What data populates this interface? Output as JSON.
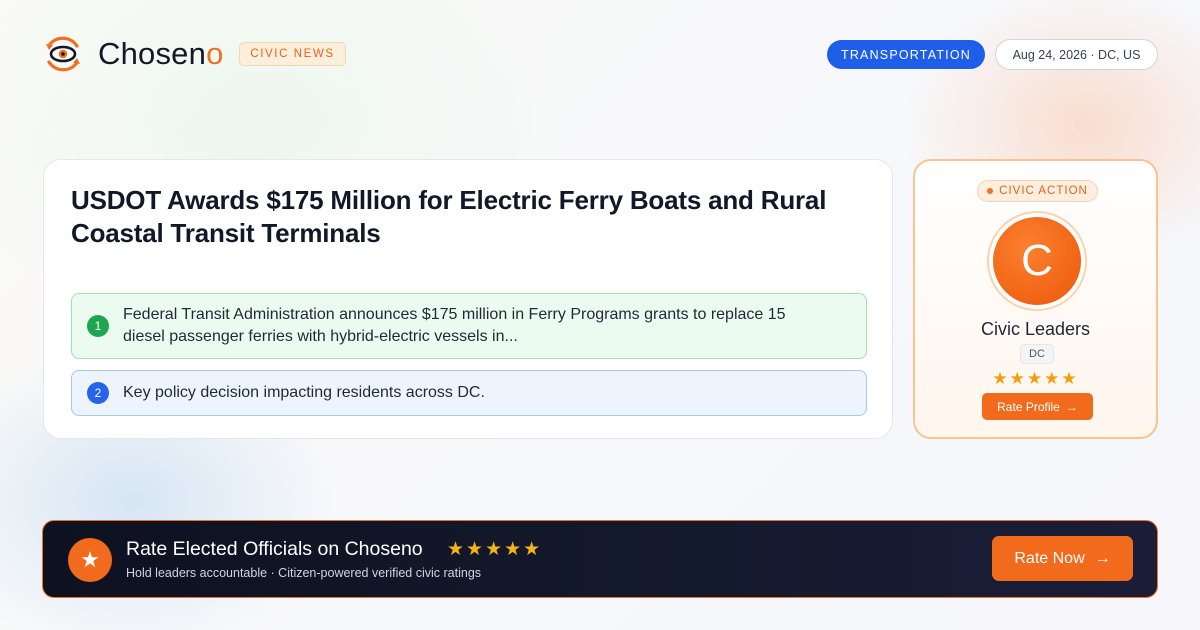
{
  "brand": {
    "name_prefix": "Chosen",
    "name_suffix": "o",
    "tag": "CIVIC NEWS",
    "accent_color": "#f07021",
    "icon": "eye-logo-icon"
  },
  "header": {
    "topic": "TRANSPORTATION",
    "date_location": "Aug 24, 2026 · DC, US"
  },
  "article": {
    "headline": "USDOT Awards $175 Million for Electric Ferry Boats and Rural Coastal Transit Terminals",
    "points": [
      {
        "number": "1",
        "text": "Federal Transit Administration announces $175 million in Ferry Programs grants to replace 15 diesel passenger ferries with hybrid-electric vessels in..."
      },
      {
        "number": "2",
        "text": "Key policy decision impacting residents across DC."
      }
    ]
  },
  "profile": {
    "badge": "CIVIC ACTION",
    "avatar_initial": "C",
    "name": "Civic Leaders",
    "region": "DC",
    "stars": "★★★★★",
    "rating": 5,
    "button_label": "Rate Profile",
    "button_arrow": "→"
  },
  "banner": {
    "icon": "star-icon",
    "icon_glyph": "★",
    "title": "Rate Elected Officials on Choseno",
    "stars": "★★★★★",
    "subtitle": "Hold leaders accountable · Citizen-powered verified civic ratings",
    "button_label": "Rate Now",
    "button_arrow": "→"
  }
}
